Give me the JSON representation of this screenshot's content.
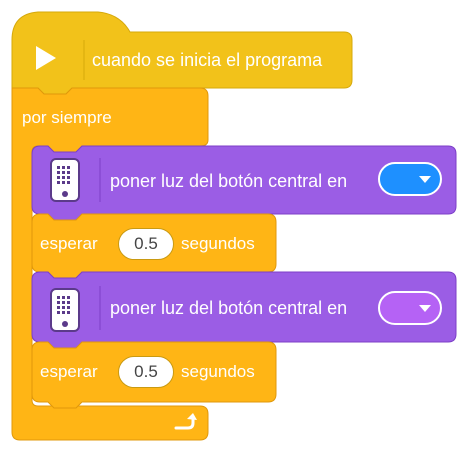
{
  "colors": {
    "event_yellow": "#f2c21a",
    "control_orange": "#ffb515",
    "control_dark": "#e0980b",
    "light_purple": "#9b5de5",
    "light_purple_dark": "#7c3fc7",
    "blue_swatch": "#1e90ff",
    "violet_swatch": "#b562f5"
  },
  "program": {
    "hat": {
      "icon": "play-flag-icon",
      "label": "cuando se inicia el programa"
    },
    "loop": {
      "label": "por siempre",
      "repeat_icon": "loop-arrow-icon"
    },
    "blocks": [
      {
        "type": "light",
        "label": "poner luz del botón central en",
        "color_name": "blue"
      },
      {
        "type": "wait",
        "prefix": "esperar",
        "value": "0.5",
        "suffix": "segundos"
      },
      {
        "type": "light",
        "label": "poner luz del botón central en",
        "color_name": "violet"
      },
      {
        "type": "wait",
        "prefix": "esperar",
        "value": "0.5",
        "suffix": "segundos"
      }
    ]
  }
}
